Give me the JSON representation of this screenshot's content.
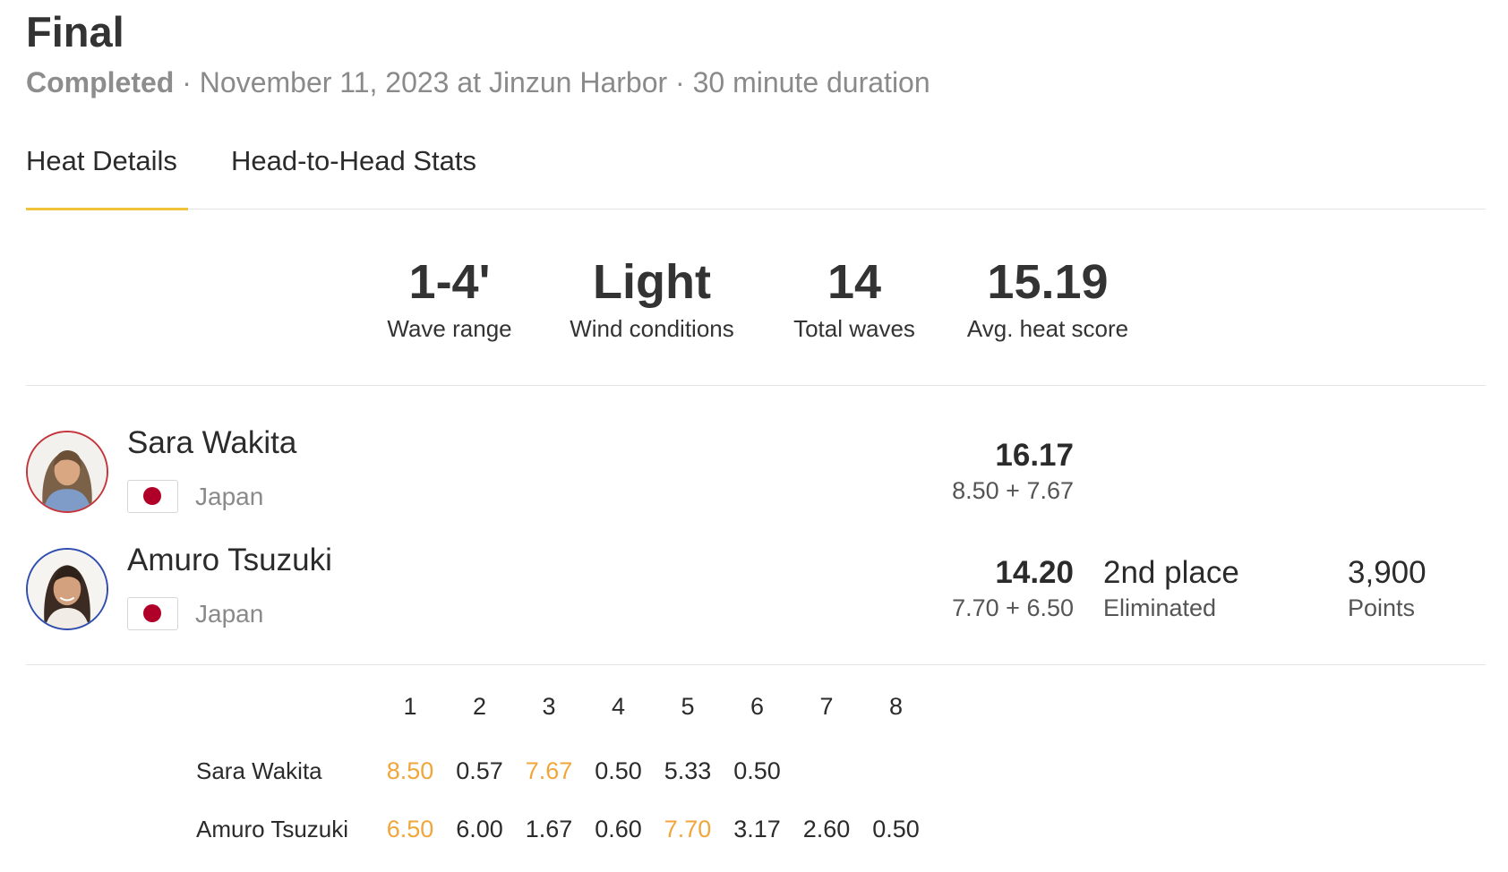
{
  "header": {
    "title": "Final",
    "status": "Completed",
    "details": " · November 11, 2023 at Jinzun Harbor · 30 minute duration"
  },
  "tabs": [
    {
      "label": "Heat Details",
      "active": true
    },
    {
      "label": "Head-to-Head Stats",
      "active": false
    }
  ],
  "stats": [
    {
      "value": "1-4'",
      "label": "Wave range"
    },
    {
      "value": "Light",
      "label": "Wind conditions"
    },
    {
      "value": "14",
      "label": "Total waves"
    },
    {
      "value": "15.19",
      "label": "Avg. heat score"
    }
  ],
  "athletes": [
    {
      "name": "Sara Wakita",
      "country": "Japan",
      "total": "16.17",
      "breakdown": "8.50 + 7.67",
      "avatar_ring_color": "#c4343b"
    },
    {
      "name": "Amuro Tsuzuki",
      "country": "Japan",
      "total": "14.20",
      "breakdown": "7.70 + 6.50",
      "place": "2nd place",
      "place_status": "Eliminated",
      "points": "3,900",
      "points_label": "Points",
      "avatar_ring_color": "#2f4db0"
    }
  ],
  "wave_table": {
    "headers": [
      "1",
      "2",
      "3",
      "4",
      "5",
      "6",
      "7",
      "8"
    ],
    "rows": [
      {
        "name": "Sara Wakita",
        "scores": [
          "8.50",
          "0.57",
          "7.67",
          "0.50",
          "5.33",
          "0.50",
          "",
          ""
        ],
        "counting": [
          0,
          2
        ]
      },
      {
        "name": "Amuro Tsuzuki",
        "scores": [
          "6.50",
          "6.00",
          "1.67",
          "0.60",
          "7.70",
          "3.17",
          "2.60",
          "0.50"
        ],
        "counting": [
          0,
          4
        ]
      }
    ],
    "highlight_color": "#f0a63a"
  },
  "colors": {
    "accent_underline": "#f0c33c",
    "japan_flag_red": "#b0002a"
  }
}
